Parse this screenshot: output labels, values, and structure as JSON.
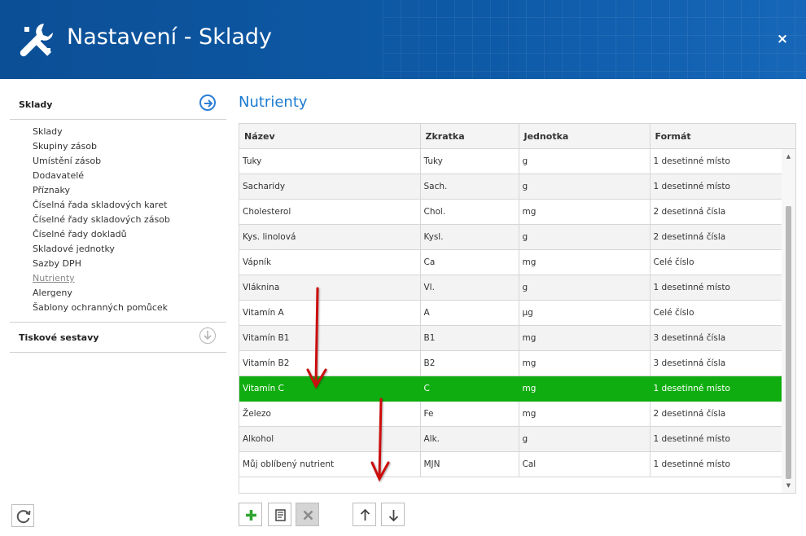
{
  "window": {
    "title": "Nastavení - Sklady",
    "close_icon": "×"
  },
  "sidebar": {
    "sections": [
      {
        "label": "Sklady",
        "icon": "arrow-right-circle-icon",
        "expanded": true
      },
      {
        "label": "Tiskové sestavy",
        "icon": "arrow-down-circle-icon",
        "expanded": false
      }
    ],
    "items": [
      {
        "label": "Sklady"
      },
      {
        "label": "Skupiny zásob"
      },
      {
        "label": "Umístění zásob"
      },
      {
        "label": "Dodavatelé"
      },
      {
        "label": "Příznaky"
      },
      {
        "label": "Číselná řada skladových karet"
      },
      {
        "label": "Číselné řady skladových zásob"
      },
      {
        "label": "Číselné řady dokladů"
      },
      {
        "label": "Skladové jednotky"
      },
      {
        "label": "Sazby DPH"
      },
      {
        "label": "Nutrienty",
        "active": true
      },
      {
        "label": "Alergeny"
      },
      {
        "label": "Šablony ochranných pomůcek"
      }
    ]
  },
  "main": {
    "title": "Nutrienty",
    "columns": [
      "Název",
      "Zkratka",
      "Jednotka",
      "Formát"
    ],
    "selected_row": 9,
    "rows": [
      [
        "Tuky",
        "Tuky",
        "g",
        "1 desetinné místo"
      ],
      [
        "Sacharidy",
        "Sach.",
        "g",
        "1 desetinné místo"
      ],
      [
        "Cholesterol",
        "Chol.",
        "mg",
        "2 desetinná čísla"
      ],
      [
        "Kys. linolová",
        "Kysl.",
        "g",
        "2 desetinná čísla"
      ],
      [
        "Vápník",
        "Ca",
        "mg",
        "Celé číslo"
      ],
      [
        "Vláknina",
        "Vl.",
        "g",
        "1 desetinné místo"
      ],
      [
        "Vitamín A",
        "A",
        "µg",
        "Celé číslo"
      ],
      [
        "Vitamín B1",
        "B1",
        "mg",
        "3 desetinná čísla"
      ],
      [
        "Vitamín B2",
        "B2",
        "mg",
        "3 desetinná čísla"
      ],
      [
        "Vitamín C",
        "C",
        "mg",
        "1 desetinné místo"
      ],
      [
        "Železo",
        "Fe",
        "mg",
        "2 desetinná čísla"
      ],
      [
        "Alkohol",
        "Alk.",
        "g",
        "1 desetinné místo"
      ],
      [
        "Můj oblíbený nutrient",
        "MJN",
        "Cal",
        "1 desetinné místo"
      ]
    ]
  },
  "toolbar": {
    "buttons": [
      {
        "icon": "plus-icon",
        "enabled": true
      },
      {
        "icon": "edit-icon",
        "enabled": true
      },
      {
        "icon": "delete-icon",
        "enabled": false
      },
      {
        "icon": "arrow-up-icon",
        "enabled": true
      },
      {
        "icon": "arrow-down-icon",
        "enabled": true
      }
    ]
  },
  "colors": {
    "header": "#0e5aa7",
    "accent": "#1a7bd0",
    "selected_row": "#10ad10",
    "annotation_arrow": "#cc1111"
  }
}
